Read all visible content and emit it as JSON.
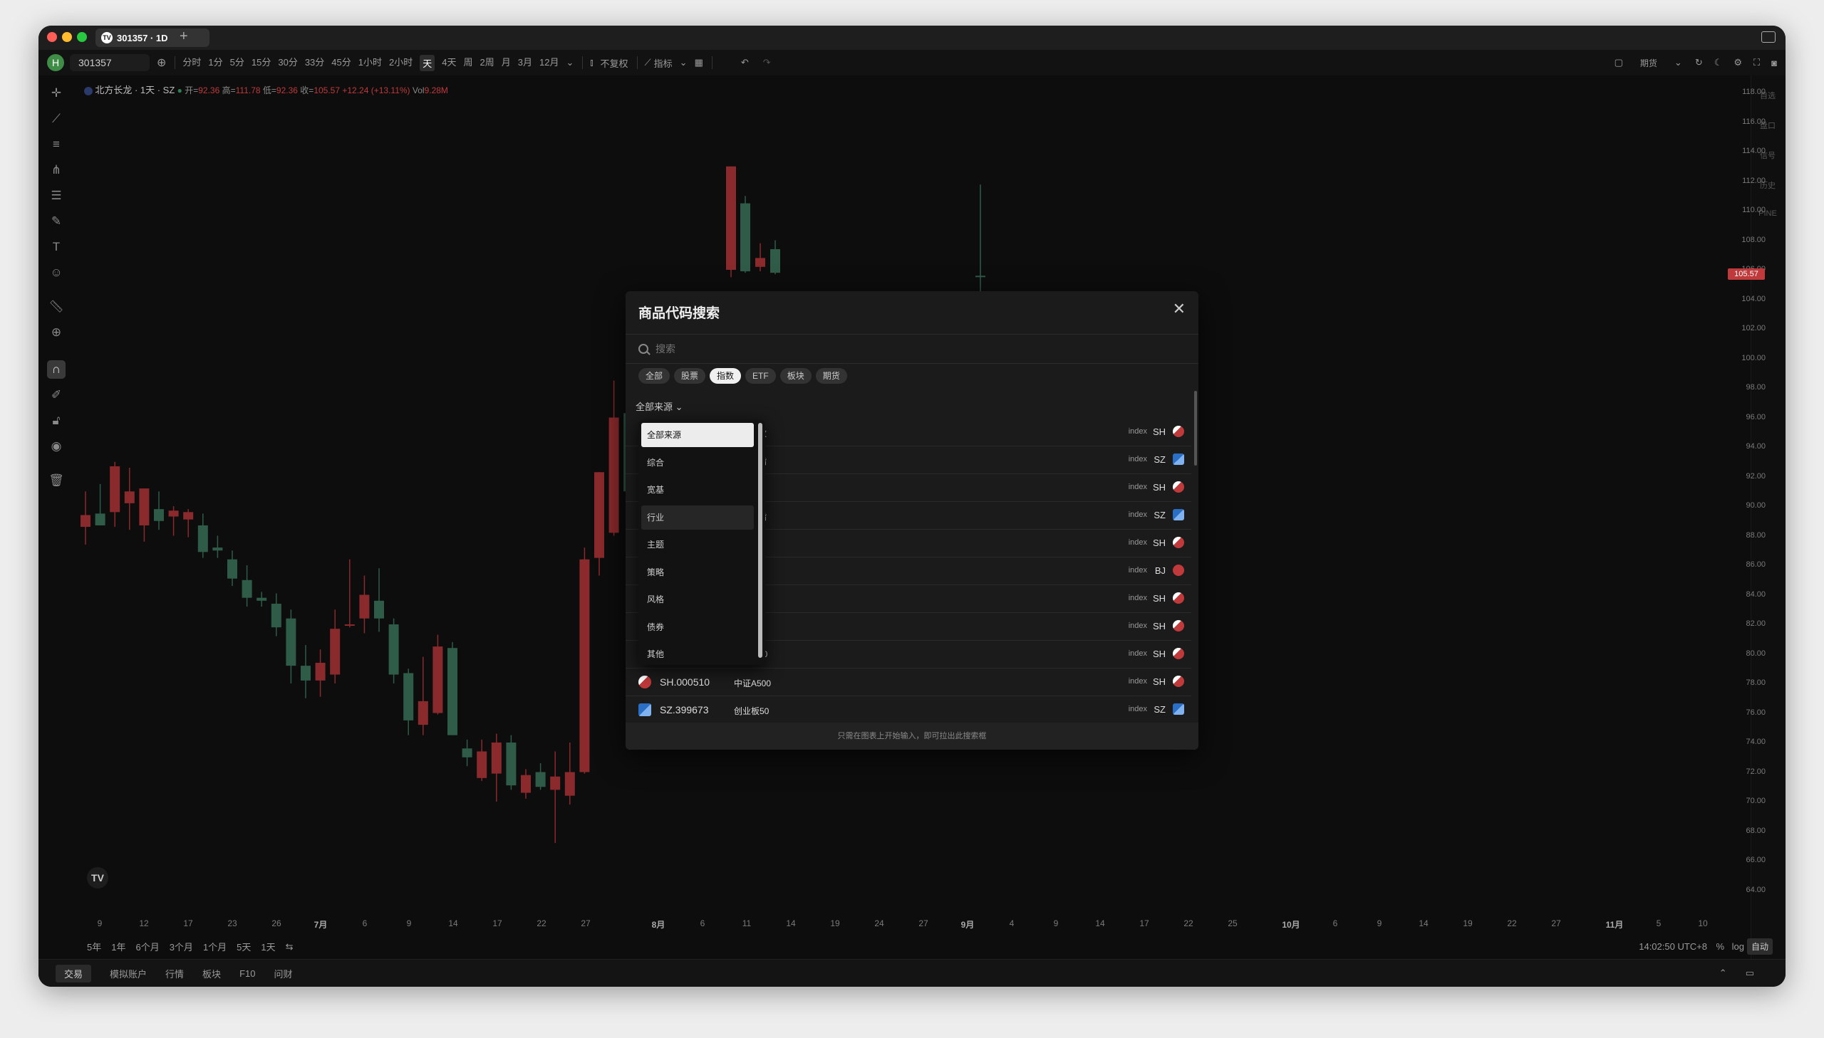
{
  "window": {
    "tab_title": "301357 · 1D",
    "tab_logo": "TV",
    "new_tab": "+"
  },
  "toolbar": {
    "avatar": "H",
    "symbol": "301357",
    "intervals": [
      "分时",
      "1分",
      "5分",
      "15分",
      "30分",
      "33分",
      "45分",
      "1小时",
      "2小时",
      "天",
      "4天",
      "周",
      "2周",
      "月",
      "3月",
      "12月"
    ],
    "active_interval": "天",
    "adjust": "不复权",
    "indicators": "指标",
    "futures": "期货"
  },
  "legend": {
    "symbol": "北方长龙 · 1天 · SZ",
    "open_label": "开=",
    "open": "92.36",
    "high_label": "高=",
    "high": "111.78",
    "low_label": "低=",
    "low": "92.36",
    "close_label": "收=",
    "close": "105.57",
    "change": "+12.24 (+13.11%)",
    "vol_label": "Vol",
    "vol": "9.28M"
  },
  "price_axis": {
    "labels": [
      "118.00",
      "116.00",
      "114.00",
      "112.00",
      "110.00",
      "108.00",
      "106.00",
      "104.00",
      "102.00",
      "100.00",
      "98.00",
      "96.00",
      "94.00",
      "92.00",
      "90.00",
      "88.00",
      "86.00",
      "84.00",
      "82.00",
      "80.00",
      "78.00",
      "76.00",
      "74.00",
      "72.00",
      "70.00",
      "68.00",
      "66.00",
      "64.00"
    ],
    "current_price": "105.57"
  },
  "right_panel": {
    "items": [
      "自选",
      "盘口",
      "信号",
      "历史",
      "PINE"
    ]
  },
  "time_axis": {
    "labels": [
      {
        "t": "9",
        "b": false
      },
      {
        "t": "12",
        "b": false
      },
      {
        "t": "17",
        "b": false
      },
      {
        "t": "23",
        "b": false
      },
      {
        "t": "26",
        "b": false
      },
      {
        "t": "7月",
        "b": true
      },
      {
        "t": "6",
        "b": false
      },
      {
        "t": "9",
        "b": false
      },
      {
        "t": "14",
        "b": false
      },
      {
        "t": "17",
        "b": false
      },
      {
        "t": "22",
        "b": false
      },
      {
        "t": "27",
        "b": false
      },
      {
        "t": "8月",
        "b": true
      },
      {
        "t": "6",
        "b": false
      },
      {
        "t": "11",
        "b": false
      },
      {
        "t": "14",
        "b": false
      },
      {
        "t": "19",
        "b": false
      },
      {
        "t": "24",
        "b": false
      },
      {
        "t": "27",
        "b": false
      },
      {
        "t": "9月",
        "b": true
      },
      {
        "t": "4",
        "b": false
      },
      {
        "t": "9",
        "b": false
      },
      {
        "t": "14",
        "b": false
      },
      {
        "t": "17",
        "b": false
      },
      {
        "t": "22",
        "b": false
      },
      {
        "t": "25",
        "b": false
      },
      {
        "t": "10月",
        "b": true
      },
      {
        "t": "6",
        "b": false
      },
      {
        "t": "9",
        "b": false
      },
      {
        "t": "14",
        "b": false
      },
      {
        "t": "19",
        "b": false
      },
      {
        "t": "22",
        "b": false
      },
      {
        "t": "27",
        "b": false
      },
      {
        "t": "11月",
        "b": true
      },
      {
        "t": "5",
        "b": false
      },
      {
        "t": "10",
        "b": false
      }
    ]
  },
  "range_bar": {
    "ranges": [
      "5年",
      "1年",
      "6个月",
      "3个月",
      "1个月",
      "5天",
      "1天"
    ],
    "clock": "14:02:50 UTC+8",
    "percent": "%",
    "log": "log",
    "auto": "自动"
  },
  "bottom_bar": {
    "tabs": [
      "交易",
      "模拟账户",
      "行情",
      "板块",
      "F10",
      "问财"
    ]
  },
  "dialog": {
    "title": "商品代码搜索",
    "search_placeholder": "搜索",
    "chips": [
      "全部",
      "股票",
      "指数",
      "ETF",
      "板块",
      "期货"
    ],
    "active_chip": "指数",
    "source_select": "全部来源",
    "rows": [
      {
        "partial": "数",
        "type": "index",
        "exchange": "SH"
      },
      {
        "partial": "指",
        "type": "index",
        "exchange": "SZ"
      },
      {
        "partial": "0",
        "type": "index",
        "exchange": "SH"
      },
      {
        "partial": "指",
        "type": "index",
        "exchange": "SZ"
      },
      {
        "partial": "",
        "type": "index",
        "exchange": "SH"
      },
      {
        "partial": "",
        "type": "index",
        "exchange": "BJ"
      },
      {
        "partial": "",
        "type": "index",
        "exchange": "SH"
      },
      {
        "partial": "0",
        "type": "index",
        "exchange": "SH"
      },
      {
        "partial": "00",
        "type": "index",
        "exchange": "SH"
      },
      {
        "code": "SH.000510",
        "name": "中证A500",
        "type": "index",
        "exchange": "SH"
      },
      {
        "code": "SZ.399673",
        "name": "创业板50",
        "type": "index",
        "exchange": "SZ"
      }
    ],
    "footer": "只需在图表上开始输入，即可拉出此搜索框"
  },
  "source_dropdown": {
    "items": [
      "全部来源",
      "综合",
      "宽基",
      "行业",
      "主题",
      "策略",
      "风格",
      "债券",
      "其他"
    ],
    "selected": "全部来源",
    "hovered": "行业"
  },
  "chart_data": {
    "type": "candlestick",
    "ylim": [
      63,
      119
    ],
    "candles": [
      {
        "o": 88.6,
        "h": 91.0,
        "l": 87.4,
        "c": 89.4
      },
      {
        "o": 89.5,
        "h": 91.5,
        "l": 88.8,
        "c": 88.7
      },
      {
        "o": 89.6,
        "h": 93.0,
        "l": 88.6,
        "c": 92.7
      },
      {
        "o": 90.2,
        "h": 92.6,
        "l": 88.4,
        "c": 91.0
      },
      {
        "o": 88.7,
        "h": 91.2,
        "l": 87.6,
        "c": 91.2
      },
      {
        "o": 89.8,
        "h": 91.0,
        "l": 88.4,
        "c": 89.0
      },
      {
        "o": 89.3,
        "h": 90.0,
        "l": 88.0,
        "c": 89.7
      },
      {
        "o": 89.1,
        "h": 89.8,
        "l": 87.9,
        "c": 89.6
      },
      {
        "o": 88.7,
        "h": 89.5,
        "l": 86.5,
        "c": 86.9
      },
      {
        "o": 87.2,
        "h": 88.0,
        "l": 86.5,
        "c": 87.0
      },
      {
        "o": 86.4,
        "h": 87.0,
        "l": 84.6,
        "c": 85.1
      },
      {
        "o": 85.0,
        "h": 86.0,
        "l": 83.2,
        "c": 83.8
      },
      {
        "o": 83.8,
        "h": 84.2,
        "l": 83.2,
        "c": 83.6
      },
      {
        "o": 83.4,
        "h": 84.1,
        "l": 81.2,
        "c": 81.8
      },
      {
        "o": 82.4,
        "h": 83.0,
        "l": 78.0,
        "c": 79.2
      },
      {
        "o": 79.2,
        "h": 80.6,
        "l": 77.0,
        "c": 78.2
      },
      {
        "o": 78.2,
        "h": 80.3,
        "l": 77.1,
        "c": 79.4
      },
      {
        "o": 78.6,
        "h": 83.0,
        "l": 78.0,
        "c": 81.7
      },
      {
        "o": 82.0,
        "h": 86.4,
        "l": 81.8,
        "c": 82.0
      },
      {
        "o": 82.4,
        "h": 85.3,
        "l": 81.4,
        "c": 84.0
      },
      {
        "o": 83.6,
        "h": 85.8,
        "l": 81.5,
        "c": 82.4
      },
      {
        "o": 82.0,
        "h": 82.4,
        "l": 78.0,
        "c": 78.6
      },
      {
        "o": 78.7,
        "h": 79.0,
        "l": 74.5,
        "c": 75.5
      },
      {
        "o": 75.2,
        "h": 79.8,
        "l": 74.5,
        "c": 76.8
      },
      {
        "o": 76.0,
        "h": 81.3,
        "l": 75.9,
        "c": 80.5
      },
      {
        "o": 80.4,
        "h": 80.8,
        "l": 74.5,
        "c": 74.5
      },
      {
        "o": 73.6,
        "h": 74.2,
        "l": 72.4,
        "c": 73.0
      },
      {
        "o": 71.6,
        "h": 74.2,
        "l": 71.4,
        "c": 73.4
      },
      {
        "o": 71.9,
        "h": 74.6,
        "l": 70.0,
        "c": 74.0
      },
      {
        "o": 74.0,
        "h": 74.5,
        "l": 70.8,
        "c": 71.1
      },
      {
        "o": 70.6,
        "h": 72.2,
        "l": 70.2,
        "c": 71.8
      },
      {
        "o": 72.0,
        "h": 72.6,
        "l": 70.8,
        "c": 71.0
      },
      {
        "o": 70.8,
        "h": 73.4,
        "l": 67.2,
        "c": 71.7
      },
      {
        "o": 70.4,
        "h": 74.0,
        "l": 69.8,
        "c": 72.0
      },
      {
        "o": 72.0,
        "h": 87.2,
        "l": 71.9,
        "c": 86.4
      },
      {
        "o": 86.5,
        "h": 92.3,
        "l": 85.3,
        "c": 92.3
      },
      {
        "o": 88.2,
        "h": 98.5,
        "l": 88.0,
        "c": 96.0
      },
      {
        "o": 96.3,
        "h": 99.0,
        "l": 90.0,
        "c": 91.0
      },
      {
        "o": 90.8,
        "h": 93.6,
        "l": 89.0,
        "c": 93.6
      },
      {
        "o": 90.6,
        "h": 92.9,
        "l": 89.2,
        "c": 91.8
      }
    ],
    "visible_upper": [
      {
        "o": 106.0,
        "h": 113.0,
        "l": 105.5,
        "c": 113.0
      },
      {
        "o": 110.5,
        "h": 111.0,
        "l": 105.8,
        "c": 105.9
      },
      {
        "o": 106.2,
        "h": 107.8,
        "l": 105.9,
        "c": 106.8
      },
      {
        "o": 107.4,
        "h": 108.0,
        "l": 105.7,
        "c": 105.8
      },
      {
        "o": 105.6,
        "h": 111.78,
        "l": 92.36,
        "c": 105.57
      }
    ]
  },
  "colors": {
    "up": "#8b2a2d",
    "down": "#2f5c49",
    "accent_red": "#c0393b"
  }
}
